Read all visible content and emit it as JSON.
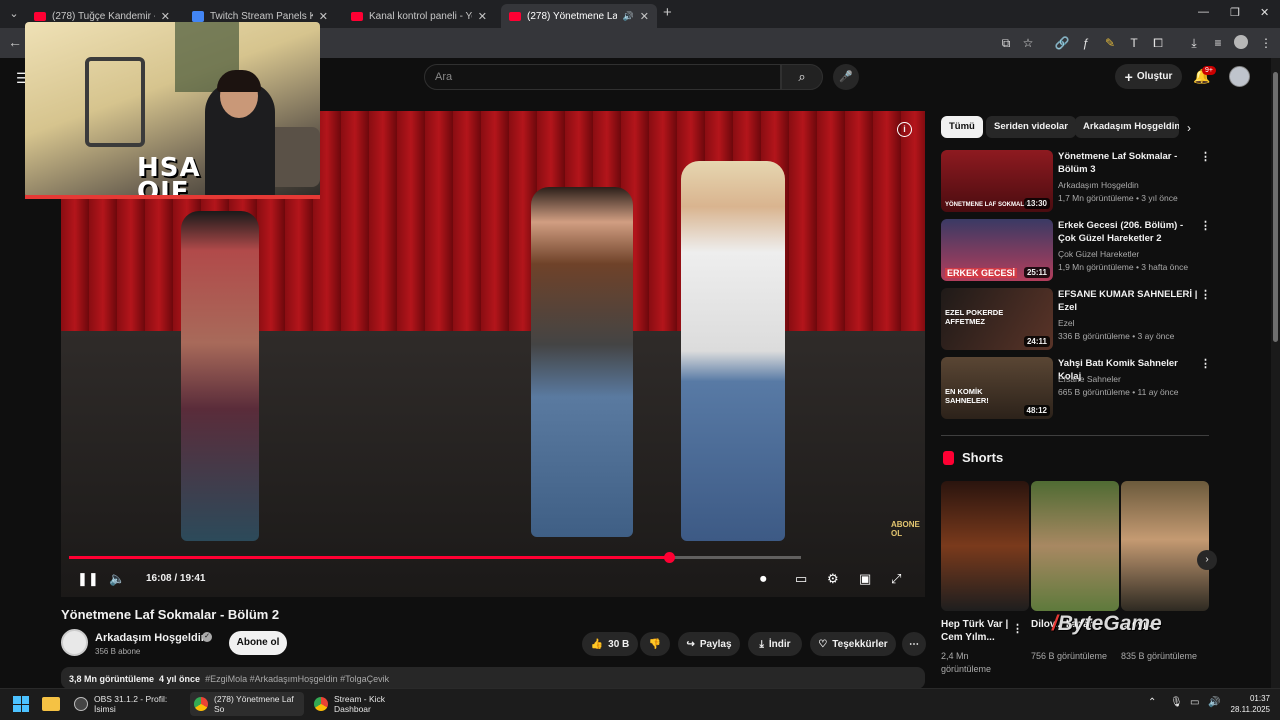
{
  "browser": {
    "tabs": [
      {
        "title": "(278) Tuğçe Kandemir - Aradan",
        "favicon": "youtube-icon"
      },
      {
        "title": "Twitch Stream Panels Konzept V",
        "favicon": "document-icon"
      },
      {
        "title": "Kanal kontrol paneli - YouTube",
        "favicon": "youtube-icon"
      },
      {
        "title": "(278) Yönetmene Laf Sokma",
        "favicon": "youtube-icon",
        "active": true
      }
    ]
  },
  "webcam": {
    "logo_line1": "HSA",
    "logo_line2": "OJF"
  },
  "youtube": {
    "search_placeholder": "Ara",
    "create_label": "Oluştur",
    "notifications_badge": "9+"
  },
  "player": {
    "current_time": "16:08",
    "duration": "19:41",
    "time_display": "16:08 / 19:41",
    "progress": 0.82,
    "buffered": 0.97,
    "watermark_line1": "ABONE",
    "watermark_line2": "OL"
  },
  "video": {
    "title": "Yönetmene Laf Sokmalar - Bölüm 2",
    "channel": "Arkadaşım Hoşgeldin",
    "subscribers": "356 B abone",
    "subscribe_label": "Abone ol",
    "likes": "30 B",
    "share_label": "Paylaş",
    "download_label": "İndir",
    "thanks_label": "Teşekkürler",
    "views": "3,8 Mn görüntüleme",
    "age": "4 yıl önce",
    "tags": "#EzgiMola #ArkadaşımHoşgeldin #TolgaÇevik"
  },
  "chips": [
    "Tümü",
    "Seriden videolar",
    "Arkadaşım Hoşgeldin"
  ],
  "recommendations": [
    {
      "title": "Yönetmene Laf Sokmalar - Bölüm 3",
      "channel": "Arkadaşım Hoşgeldin",
      "meta": "1,7 Mn görüntüleme • 3 yıl önce",
      "duration": "13:30",
      "thumb_color": "#7a1c22",
      "thumb_caption": "YÖNETMENE LAF SOKMALAR"
    },
    {
      "title": "Erkek Gecesi (206. Bölüm) - Çok Güzel Hareketler 2",
      "channel": "Çok Güzel Hareketler",
      "meta": "1,9 Mn görüntüleme • 3 hafta önce",
      "duration": "25:11",
      "thumb_color": "#b33e5c",
      "thumb_caption": "ERKEK GECESİ"
    },
    {
      "title": "EFSANE KUMAR SAHNELERİ | Ezel",
      "channel": "Ezel",
      "meta": "336 B görüntüleme • 3 ay önce",
      "duration": "24:11",
      "thumb_color": "#3c2a24",
      "thumb_caption": "EZEL POKERDE AFFETMEZ"
    },
    {
      "title": "Yahşi Batı Komik Sahneler Kolaj",
      "channel": "Efsane Sahneler",
      "meta": "665 B görüntüleme • 11 ay önce",
      "duration": "48:12",
      "thumb_color": "#4a3b2e",
      "thumb_caption": "EN KOMİK SAHNELER!"
    }
  ],
  "shorts": {
    "heading": "Shorts",
    "items": [
      {
        "title": "Hep Türk Var | Cem Yılm...",
        "views": "2,4 Mn görüntüleme",
        "color": "#3a1d16"
      },
      {
        "title": "Dilov... kadar",
        "views": "756 B görüntüleme",
        "color": "#6d8a4a"
      },
      {
        "title": "... eyj...",
        "views": "835 B görüntüleme",
        "color": "#5d4a2e"
      }
    ]
  },
  "overlay_brand": {
    "part1": "By",
    "slash": "/",
    "part2": "ByteGame"
  },
  "taskbar": {
    "items": [
      {
        "label": "OBS 31.1.2 - Profil: İsimsi",
        "icon_color": "#444"
      },
      {
        "label": "(278) Yönetmene Laf So",
        "icon_color": "#4285f4",
        "active": true
      },
      {
        "label": "Stream - Kick Dashboar",
        "icon_color": "#4285f4"
      }
    ],
    "time": "01:37",
    "date": "28.11.2025"
  }
}
